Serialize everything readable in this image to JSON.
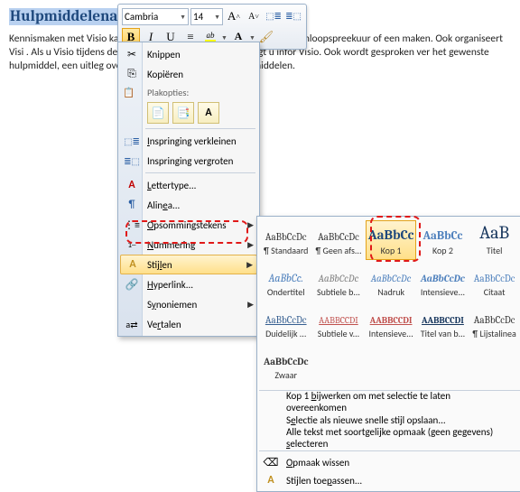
{
  "doc": {
    "heading": "Hulpmiddelenadvies",
    "body": "Kennismaken met Visio kan                                             kunt vrijblijvend binnen lopen tijdens het inloopspreekuur of een maken. Ook organiseert Visi                                         . Als u Visio tijdens deze gelegenheden bezoekt, ontvangt u infor Visio. Ook wordt gesproken                                        ver het gewenste hulpmiddel, een uitleg over het gebruik ervan en van hulpmiddelen."
  },
  "toolbar": {
    "font": "Cambria",
    "size": "14",
    "bold": "B",
    "italic": "I",
    "underline": "U",
    "center": "≡",
    "highlight_glyph": "ab",
    "fontcolor_glyph": "A",
    "grow": "A˄",
    "shrink": "A˅",
    "indent_less": "←≡",
    "indent_more": "≡→",
    "format_painter": "✂"
  },
  "ctx": {
    "cut": "Knippen",
    "copy": "Kopiëren",
    "paste_label": "Plakopties:",
    "font_dlg": "Lettertype...",
    "paragraph": "Alinea...",
    "bullets": "Opsommingstekens",
    "numbering": "Nummering",
    "styles": "Stijlen",
    "hyperlink": "Hyperlink...",
    "synonyms": "Synoniemen",
    "translate": "Vertalen",
    "indent_less": "Inspringing verkleinen",
    "indent_more": "Inspringing vergroten"
  },
  "gallery": {
    "styles": [
      {
        "preview": "AaBbCcDc",
        "label": "¶ Standaard",
        "css": "font-size:11px;color:#333;"
      },
      {
        "preview": "AaBbCcDc",
        "label": "¶ Geen afs...",
        "css": "font-size:11px;color:#333;"
      },
      {
        "preview": "AaBbCc",
        "label": "Kop 1",
        "css": "font-size:15px;color:#1f497d;font-weight:bold;"
      },
      {
        "preview": "AaBbCc",
        "label": "Kop 2",
        "css": "font-size:13px;color:#4f81bd;font-weight:bold;"
      },
      {
        "preview": "AaB",
        "label": "Titel",
        "css": "font-size:20px;color:#17365d;"
      },
      {
        "preview": "AaBbCc.",
        "label": "Ondertitel",
        "css": "font-size:12px;color:#4f81bd;font-style:italic;"
      },
      {
        "preview": "AaBbCcDc",
        "label": "Subtiele b...",
        "css": "font-size:11px;color:#808080;font-style:italic;"
      },
      {
        "preview": "AaBbCcDc",
        "label": "Nadruk",
        "css": "font-size:11px;color:#4f81bd;font-style:italic;"
      },
      {
        "preview": "AaBbCcDc",
        "label": "Intensieve...",
        "css": "font-size:11px;color:#4f81bd;font-style:italic;font-weight:bold;"
      },
      {
        "preview": "AaBbCcDc",
        "label": "Citaat",
        "css": "font-size:11px;color:#4f81bd;"
      },
      {
        "preview": "AaBbCcDc",
        "label": "Duidelijk ...",
        "css": "font-size:11px;color:#365f91;text-decoration:underline;"
      },
      {
        "preview": "AABBCCDI",
        "label": "Subtiele v...",
        "css": "font-size:10px;color:#c0504d;text-decoration:underline;"
      },
      {
        "preview": "AABBCCDI",
        "label": "Intensieve...",
        "css": "font-size:10px;color:#c0504d;font-weight:bold;text-decoration:underline;"
      },
      {
        "preview": "AABBCCDI",
        "label": "Titel van b...",
        "css": "font-size:10px;color:#17365d;font-weight:bold;text-decoration:underline;"
      },
      {
        "preview": "AaBbCcDc",
        "label": "¶ Lijstalinea",
        "css": "font-size:11px;color:#333;"
      },
      {
        "preview": "AaBbCcDc",
        "label": "Zwaar",
        "css": "font-size:11px;font-weight:bold;color:#333;"
      }
    ],
    "update": "Kop 1 bijwerken om met selectie te laten overeenkomen",
    "save_new": "Selectie als nieuwe snelle stijl opslaan...",
    "select_similar": "Alle tekst met soortgelijke opmaak (geen gegevens) selecteren",
    "clear": "Opmaak wissen",
    "apply": "Stijlen toepassen..."
  }
}
